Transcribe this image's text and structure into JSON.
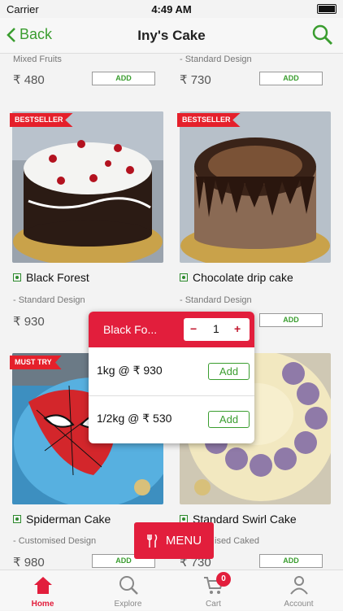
{
  "status": {
    "carrier": "Carrier",
    "time": "4:49 AM"
  },
  "navbar": {
    "back_label": "Back",
    "title": "Iny's Cake"
  },
  "top_row": [
    {
      "desc": "Mixed Fruits",
      "price": "₹ 480",
      "add": "ADD"
    },
    {
      "desc": "- Standard Design",
      "price": "₹ 730",
      "add": "ADD"
    }
  ],
  "cards": [
    {
      "tag": "BESTSELLER",
      "name": "Black Forest",
      "desc": "- Standard Design",
      "price": "₹ 930",
      "add": "ADD"
    },
    {
      "tag": "BESTSELLER",
      "name": "Chocolate drip cake",
      "desc": "- Standard Design",
      "price": "",
      "add": "ADD"
    },
    {
      "tag": "MUST TRY",
      "name": "Spiderman Cake",
      "desc": "- Customised Design",
      "price": "₹ 980",
      "add": "ADD"
    },
    {
      "tag": "",
      "name": "Standard Swirl Cake",
      "desc": "ised Caked",
      "price": "₹ 730",
      "add": "ADD"
    }
  ],
  "popup": {
    "item_name": "Black Fo...",
    "minus": "−",
    "quantity": "1",
    "plus": "+",
    "options": [
      {
        "label": "1kg @ ₹ 930",
        "add": "Add"
      },
      {
        "label": "1/2kg @ ₹ 530",
        "add": "Add"
      }
    ]
  },
  "menu_button": "MENU",
  "tabs": [
    {
      "label": "Home",
      "icon": "home-icon",
      "active": true
    },
    {
      "label": "Explore",
      "icon": "search-icon",
      "active": false
    },
    {
      "label": "Cart",
      "icon": "cart-icon",
      "active": false,
      "badge": "0"
    },
    {
      "label": "Account",
      "icon": "account-icon",
      "active": false
    }
  ],
  "colors": {
    "accent_red": "#e21e3c",
    "accent_green": "#3a9d2f"
  }
}
